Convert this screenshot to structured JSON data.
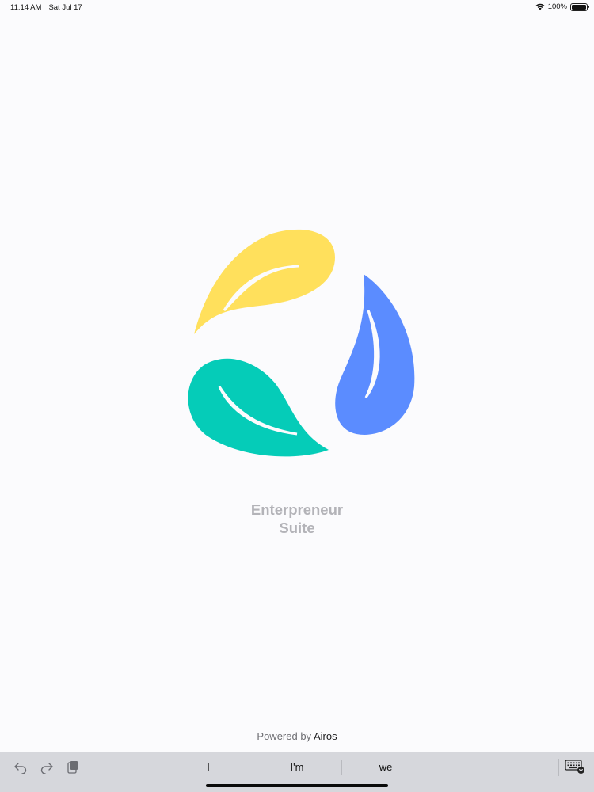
{
  "status_bar": {
    "time": "11:14 AM",
    "date": "Sat Jul 17",
    "battery": "100%",
    "battery_level": 1.0
  },
  "logo": {
    "colors": {
      "yellow": "#FFE05C",
      "blue": "#5B8CFF",
      "teal": "#05CCB8"
    }
  },
  "app": {
    "title_line1": "Enterpreneur",
    "title_line2": "Suite",
    "title_color": "#B3B3B8"
  },
  "footer": {
    "powered_by": "Powered by",
    "brand": "Airos"
  },
  "keyboard_bar": {
    "icons": [
      "undo-icon",
      "redo-icon",
      "paste-icon",
      "keyboard-icon"
    ],
    "suggestions": [
      "I",
      "I'm",
      "we"
    ]
  }
}
